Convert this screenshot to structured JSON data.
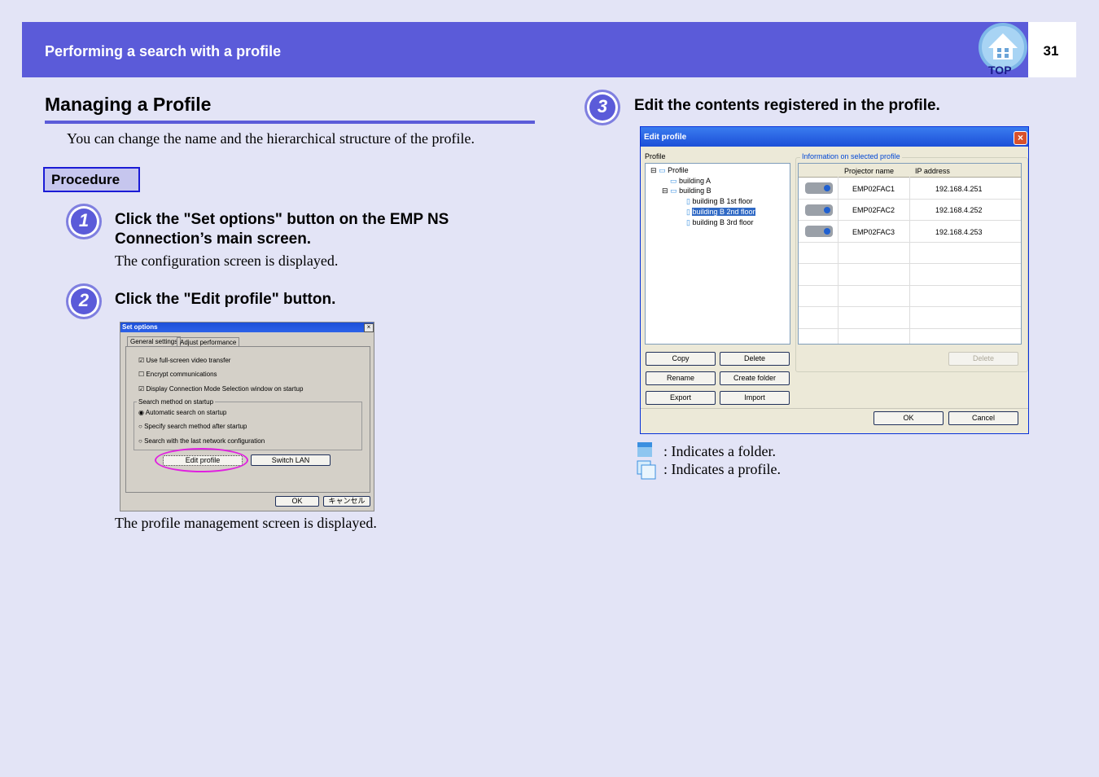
{
  "header": {
    "title": "Performing a search with a profile",
    "page_number": "31",
    "top_label": "TOP"
  },
  "section": {
    "title": "Managing a Profile",
    "intro": "You can change the name and the hierarchical structure of the profile.",
    "procedure_label": "Procedure"
  },
  "steps": [
    {
      "num": "1",
      "title_line1": "Click the \"Set options\" button on the EMP NS",
      "title_line2": "Connection’s main screen.",
      "desc": "The configuration screen is displayed."
    },
    {
      "num": "2",
      "title": "Click the \"Edit profile\" button.",
      "desc": "The profile management screen is displayed."
    },
    {
      "num": "3",
      "title": "Edit the contents registered in the profile."
    }
  ],
  "set_options": {
    "title": "Set options",
    "tabs": [
      "General settings",
      "Adjust performance"
    ],
    "checks": [
      {
        "label": "Use full-screen video transfer",
        "checked": true
      },
      {
        "label": "Encrypt communications",
        "checked": false
      },
      {
        "label": "Display Connection Mode Selection window on startup",
        "checked": true
      }
    ],
    "group_label": "Search method on startup",
    "radios": [
      {
        "label": "Automatic search on startup",
        "selected": true
      },
      {
        "label": "Specify search method after startup",
        "selected": false
      },
      {
        "label": "Search with the last network configuration",
        "selected": false
      }
    ],
    "edit_profile_btn": "Edit profile",
    "switch_lan_btn": "Switch LAN",
    "ok_btn": "OK",
    "cancel_btn": "キャンセル",
    "highlight_color": "#e020e0"
  },
  "edit_profile": {
    "title": "Edit profile",
    "profile_label": "Profile",
    "tree": [
      {
        "label": "Profile",
        "level": 0,
        "type": "folder",
        "expander": "⊟"
      },
      {
        "label": "building A",
        "level": 1,
        "type": "folder",
        "expander": ""
      },
      {
        "label": "building B",
        "level": 1,
        "type": "folder",
        "expander": "⊟"
      },
      {
        "label": "building B 1st floor",
        "level": 2,
        "type": "profile",
        "expander": ""
      },
      {
        "label": "building B 2nd floor",
        "level": 2,
        "type": "profile",
        "expander": "",
        "selected": true
      },
      {
        "label": "building B 3rd floor",
        "level": 2,
        "type": "profile",
        "expander": ""
      }
    ],
    "info_label": "Information on selected profile",
    "columns": [
      "Projector name",
      "IP address"
    ],
    "rows": [
      {
        "name": "EMP02FAC1",
        "ip": "192.168.4.251"
      },
      {
        "name": "EMP02FAC2",
        "ip": "192.168.4.252"
      },
      {
        "name": "EMP02FAC3",
        "ip": "192.168.4.253"
      }
    ],
    "buttons": {
      "copy": "Copy",
      "delete": "Delete",
      "rename": "Rename",
      "create_folder": "Create folder",
      "export": "Export",
      "import": "Import",
      "delete_disabled": "Delete",
      "ok": "OK",
      "cancel": "Cancel"
    }
  },
  "legend": {
    "folder": ": Indicates a folder.",
    "profile": ": Indicates a profile."
  },
  "colors": {
    "accent": "#5b5bd9",
    "background": "#e3e4f6",
    "xp_title": "#1c4fd8"
  }
}
